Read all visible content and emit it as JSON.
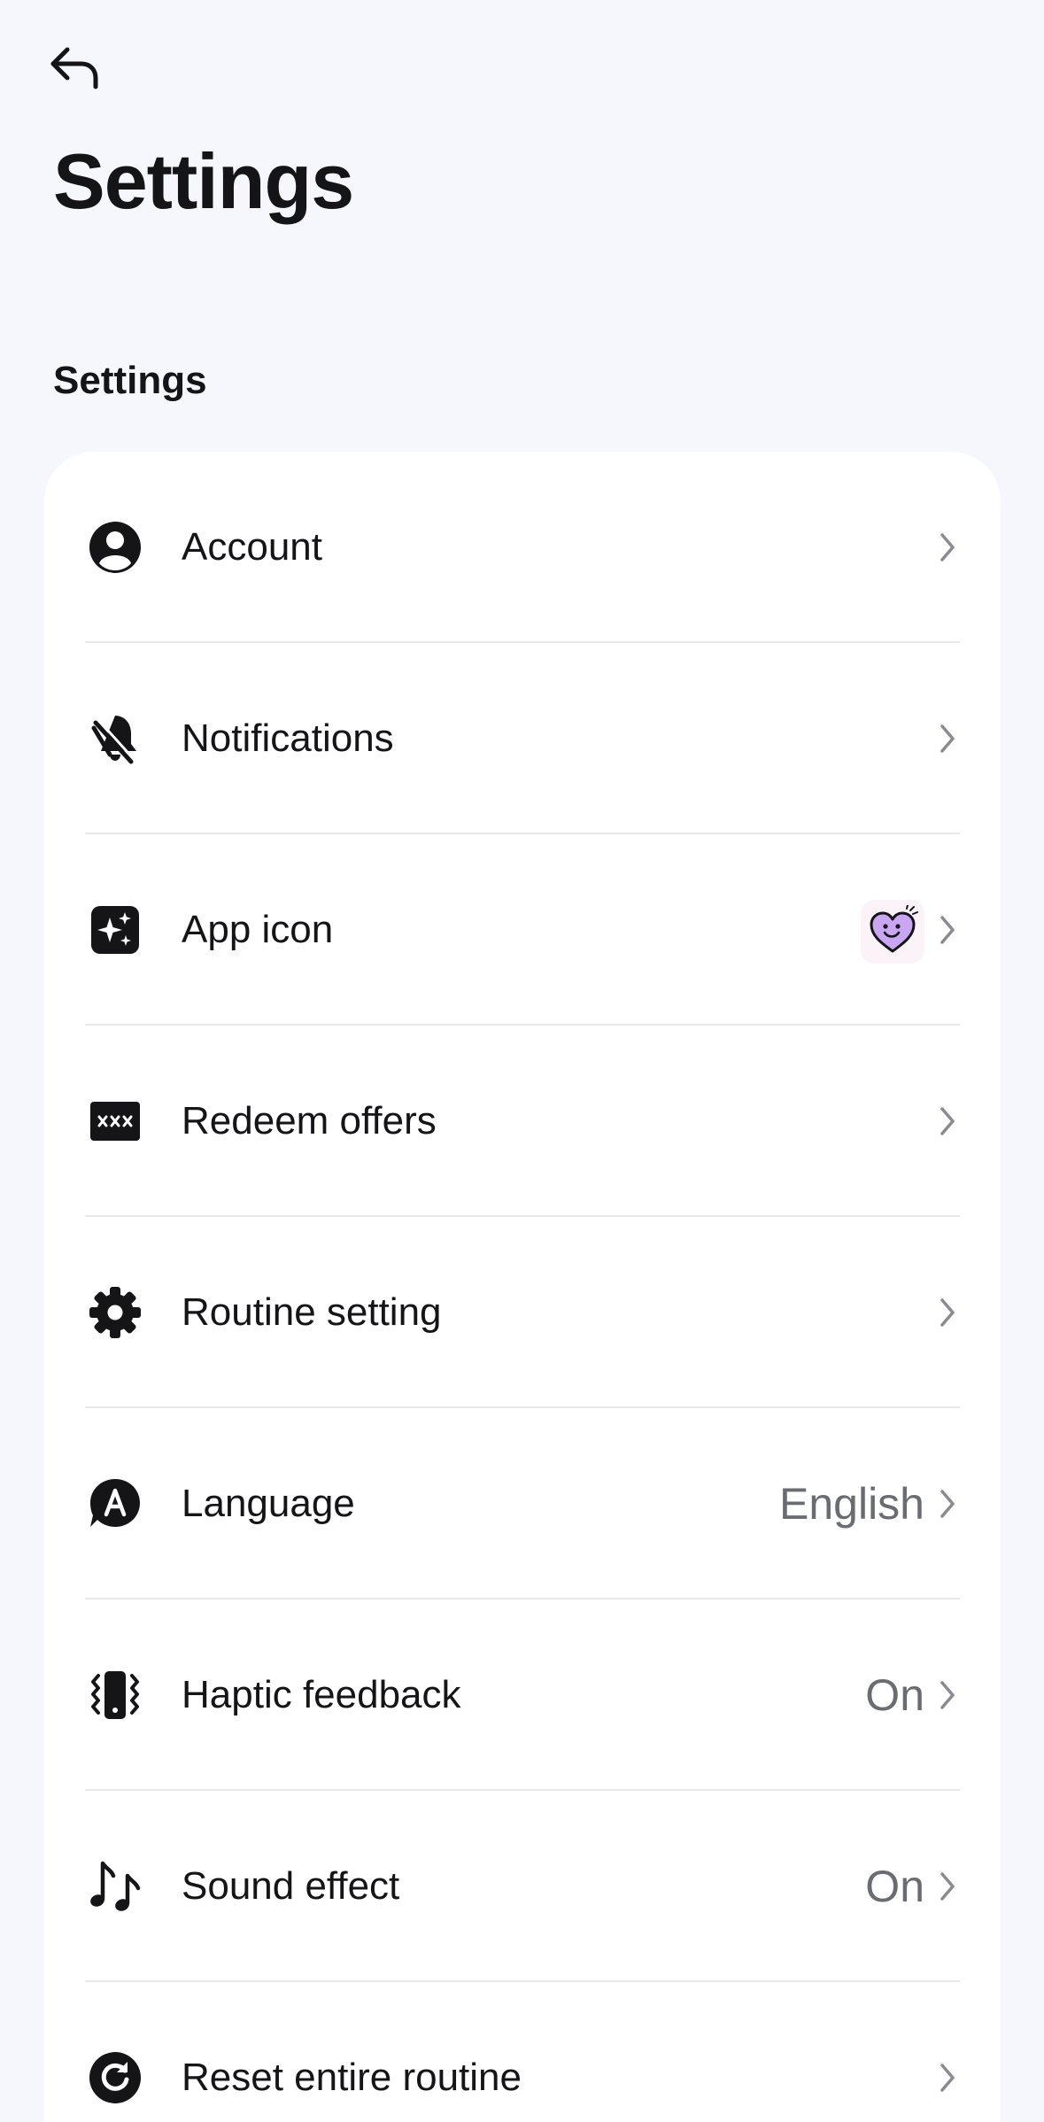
{
  "header": {
    "back_icon": "back-arrow-icon",
    "title": "Settings"
  },
  "section": {
    "title": "Settings"
  },
  "items": [
    {
      "id": "account",
      "icon": "account-icon",
      "label": "Account",
      "value": ""
    },
    {
      "id": "notifications",
      "icon": "bell-off-icon",
      "label": "Notifications",
      "value": ""
    },
    {
      "id": "app-icon",
      "icon": "sparkle-icon",
      "label": "App icon",
      "value": "",
      "thumbnail": "heart-face-icon"
    },
    {
      "id": "redeem-offers",
      "icon": "code-card-icon",
      "label": "Redeem offers",
      "value": ""
    },
    {
      "id": "routine-setting",
      "icon": "gear-icon",
      "label": "Routine setting",
      "value": ""
    },
    {
      "id": "language",
      "icon": "language-icon",
      "label": "Language",
      "value": "English"
    },
    {
      "id": "haptic-feedback",
      "icon": "vibration-icon",
      "label": "Haptic feedback",
      "value": "On"
    },
    {
      "id": "sound-effect",
      "icon": "music-note-icon",
      "label": "Sound effect",
      "value": "On"
    },
    {
      "id": "reset-routine",
      "icon": "reset-icon",
      "label": "Reset entire routine",
      "value": ""
    }
  ],
  "colors": {
    "background": "#f6f7fd",
    "card": "#ffffff",
    "text": "#151518",
    "secondary_text": "#6b6c72",
    "divider": "#e7e8ee",
    "chevron": "#8a8b91",
    "heart": "#c9a6f2"
  }
}
